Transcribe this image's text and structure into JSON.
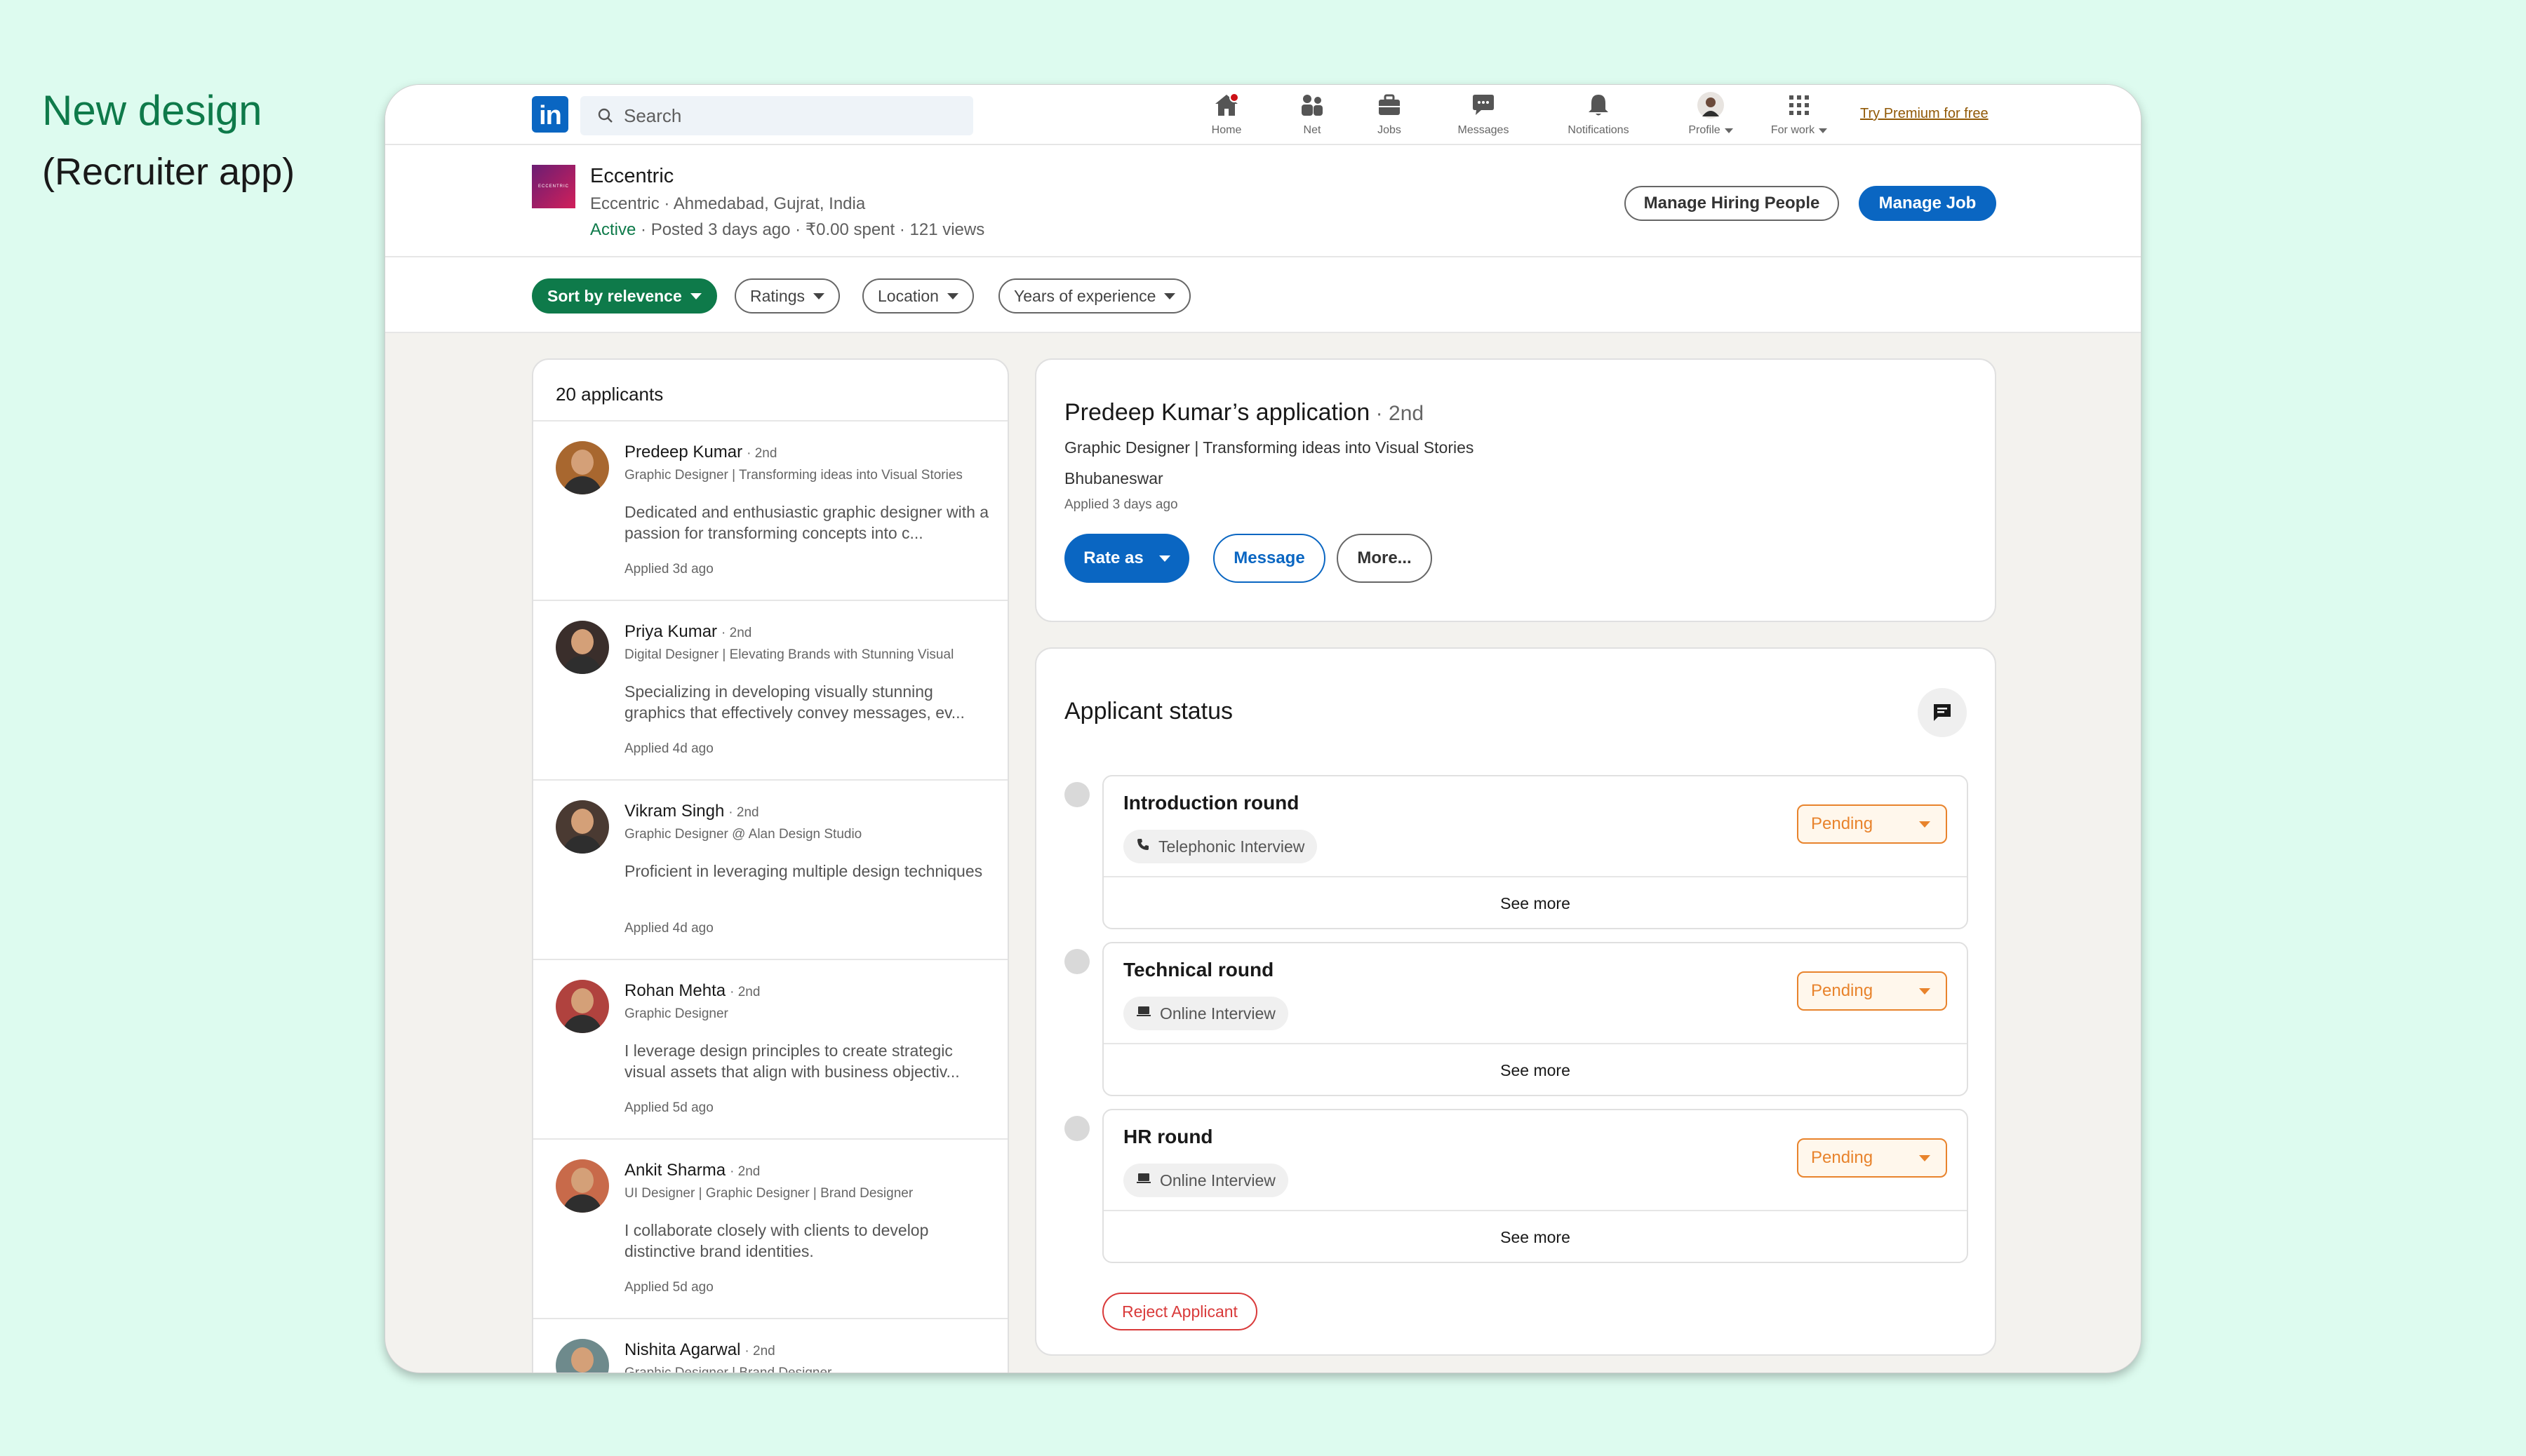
{
  "annotation": {
    "title": "New design",
    "subtitle": "(Recruiter app)"
  },
  "topnav": {
    "logo_text": "in",
    "search_placeholder": "Search",
    "items": [
      {
        "label": "Home",
        "icon": "home-icon"
      },
      {
        "label": "Net",
        "icon": "network-icon"
      },
      {
        "label": "Jobs",
        "icon": "briefcase-icon"
      },
      {
        "label": "Messages",
        "icon": "messages-icon"
      },
      {
        "label": "Notifications",
        "icon": "bell-icon"
      },
      {
        "label": "Profile",
        "icon": "profile-avatar"
      },
      {
        "label": "For work",
        "icon": "grid-icon"
      }
    ],
    "premium_link": "Try Premium for free"
  },
  "job": {
    "logo_text": "ECCENTRIC",
    "company": "Eccentric",
    "location": "Eccentric · Ahmedabad, Gujrat, India",
    "status": "Active",
    "meta": " · Posted 3 days ago · ₹0.00 spent · 121 views",
    "manage_hiring_label": "Manage Hiring People",
    "manage_job_label": "Manage Job"
  },
  "filters": [
    {
      "label": "Sort by relevence",
      "active": true
    },
    {
      "label": "Ratings",
      "active": false
    },
    {
      "label": "Location",
      "active": false
    },
    {
      "label": "Years of experience",
      "active": false
    }
  ],
  "applicants": {
    "header": "20 applicants",
    "items": [
      {
        "name": "Predeep Kumar",
        "degree": "· 2nd",
        "headline": "Graphic Designer | Transforming ideas into Visual Stories",
        "summary": "Dedicated and enthusiastic graphic designer with a passion for transforming concepts into c...",
        "applied": "Applied 3d ago",
        "avatar_color": "#A8672F"
      },
      {
        "name": "Priya Kumar",
        "degree": "· 2nd",
        "headline": "Digital Designer | Elevating Brands with Stunning Visual",
        "summary": "Specializing in developing visually stunning graphics that effectively convey messages, ev...",
        "applied": "Applied 4d ago",
        "avatar_color": "#3A2E2B"
      },
      {
        "name": "Vikram Singh",
        "degree": "· 2nd",
        "headline": "Graphic Designer @ Alan Design Studio",
        "summary": "Proficient in leveraging multiple design techniques",
        "applied": "Applied 4d ago",
        "avatar_color": "#4A3A32"
      },
      {
        "name": "Rohan Mehta",
        "degree": "· 2nd",
        "headline": "Graphic Designer",
        "summary": "I leverage design principles to create strategic visual assets that align with business objectiv...",
        "applied": "Applied 5d ago",
        "avatar_color": "#B0423E"
      },
      {
        "name": "Ankit Sharma",
        "degree": "· 2nd",
        "headline": "UI Designer | Graphic Designer | Brand Designer",
        "summary": "I collaborate closely with clients to develop distinctive brand identities.",
        "applied": "Applied 5d ago",
        "avatar_color": "#C86A4A"
      },
      {
        "name": "Nishita Agarwal",
        "degree": "· 2nd",
        "headline": "Graphic Designer | Brand Designer",
        "summary": "",
        "applied": "",
        "avatar_color": "#6E8A8C"
      }
    ]
  },
  "detail": {
    "title": "Predeep Kumar’s application",
    "degree": " · 2nd",
    "headline": "Graphic Designer | Transforming ideas into Visual Stories",
    "location": "Bhubaneswar",
    "applied": "Applied 3 days ago",
    "rate_label": "Rate as",
    "message_label": "Message",
    "more_label": "More..."
  },
  "status": {
    "title": "Applicant status",
    "rounds": [
      {
        "name": "Introduction round",
        "type": "Telephonic Interview",
        "type_icon": "phone-icon",
        "status": "Pending",
        "see_more": "See more"
      },
      {
        "name": "Technical round",
        "type": "Online Interview",
        "type_icon": "laptop-icon",
        "status": "Pending",
        "see_more": "See more"
      },
      {
        "name": "HR round",
        "type": "Online Interview",
        "type_icon": "laptop-icon",
        "status": "Pending",
        "see_more": "See more"
      }
    ],
    "reject_label": "Reject Applicant"
  },
  "colors": {
    "linkedin_blue": "#0A66C2",
    "green": "#0E7A4A",
    "pending_orange": "#E8832C",
    "reject_red": "#D93A3A"
  }
}
